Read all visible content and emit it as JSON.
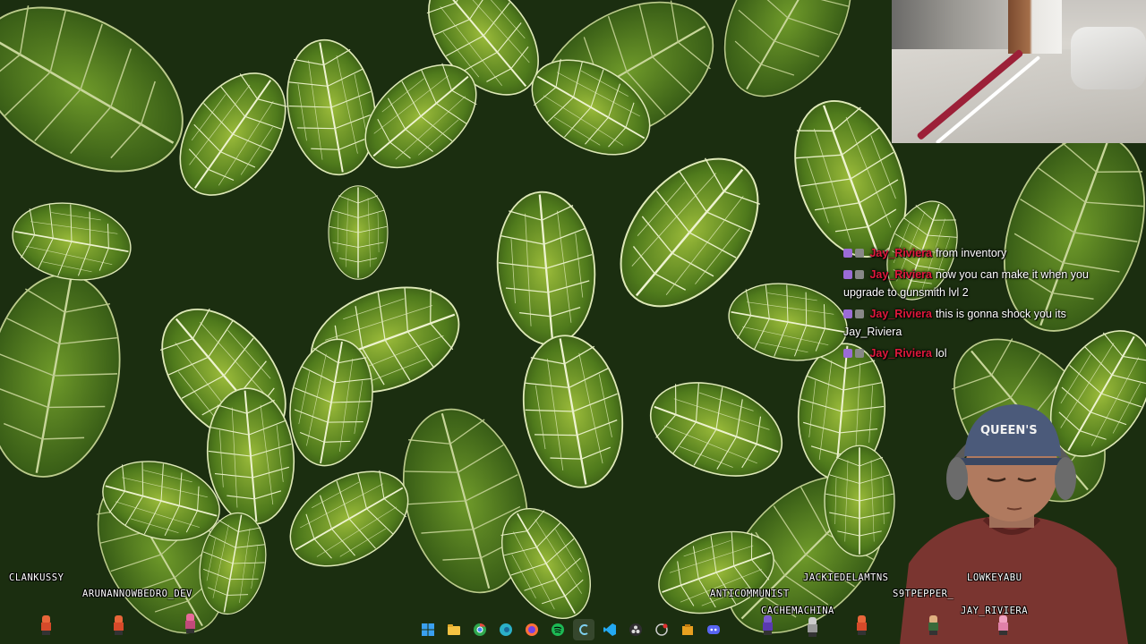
{
  "chat": {
    "messages": [
      {
        "user": "Jay_Riviera",
        "text": "from inventory"
      },
      {
        "user": "Jay_Riviera",
        "text": "now you can make it when you upgrade to gunsmith lvl 2"
      },
      {
        "user": "Jay_Riviera",
        "text": "this is gonna shock you its Jay_Riviera"
      },
      {
        "user": "Jay_Riviera",
        "text": "lol"
      }
    ],
    "colors": {
      "username": "#e0193c",
      "sub_badge": "#9b6bd6"
    }
  },
  "chatters": {
    "clankussy": "CLANKUSSY",
    "arunannowbedro": "ARUNANNOWBEDRO_DEV",
    "anticommunist": "ANTICOMMUNIST",
    "jackiedelamtns": "JACKIEDELAMTNS",
    "lowkeyabu": "LOWKEYABU",
    "s9tpepper": "S9TPEPPER_",
    "cachemachina": "CACHEMACHINA",
    "jay_riviera": "JAY_RIVIERA"
  },
  "taskbar": {
    "icons": [
      "windows-start-icon",
      "file-explorer-icon",
      "chrome-icon",
      "edge-icon",
      "firefox-icon",
      "spotify-icon",
      "app-c-icon",
      "vscode-icon",
      "obs-icon",
      "recorder-icon",
      "folder-icon",
      "discord-icon"
    ]
  }
}
